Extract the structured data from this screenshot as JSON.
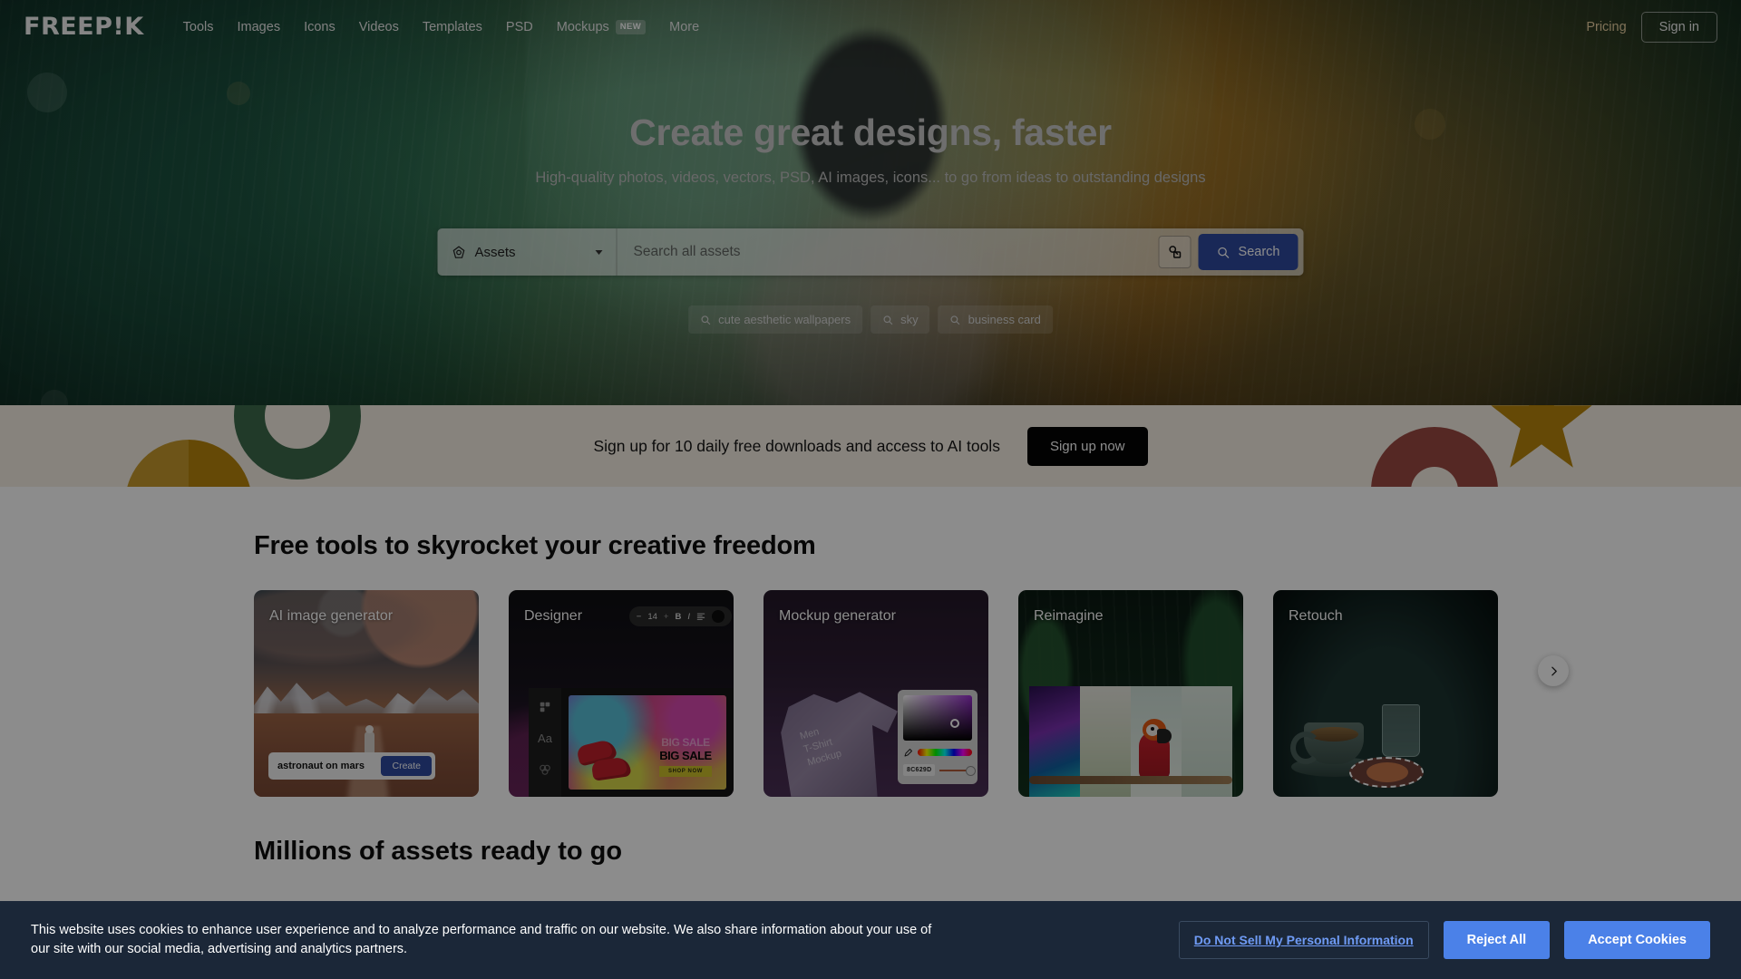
{
  "nav": {
    "logo": "FREEP!K",
    "links": [
      {
        "label": "Tools"
      },
      {
        "label": "Images"
      },
      {
        "label": "Icons"
      },
      {
        "label": "Videos"
      },
      {
        "label": "Templates"
      },
      {
        "label": "PSD"
      },
      {
        "label": "Mockups",
        "badge": "NEW"
      },
      {
        "label": "More"
      }
    ],
    "pricing_label": "Pricing",
    "signin_label": "Sign in"
  },
  "hero": {
    "title": "Create great designs, faster",
    "subtitle": "High-quality photos, videos, vectors, PSD, AI images, icons... to go from ideas to outstanding designs",
    "search": {
      "category_label": "Assets",
      "placeholder": "Search all assets",
      "value": "",
      "button_label": "Search",
      "image_search_icon": "image-search-icon"
    },
    "chips": [
      {
        "label": "cute aesthetic wallpapers"
      },
      {
        "label": "sky"
      },
      {
        "label": "business card"
      }
    ]
  },
  "signup_strip": {
    "text": "Sign up for 10 daily free downloads and access to AI tools",
    "button_label": "Sign up now",
    "shape_colors": {
      "green": "#3d6b4c",
      "yellow": "#c79a2c",
      "gold": "#b8860b",
      "red": "#9c4a42"
    }
  },
  "tools_section": {
    "title": "Free tools to skyrocket your creative freedom",
    "next_arrow_icon": "chevron-right-icon",
    "cards": [
      {
        "label": "AI image generator",
        "prompt_value": "astronaut on mars",
        "create_label": "Create"
      },
      {
        "label": "Designer",
        "toolbar": {
          "minus": "−",
          "font_size": "14",
          "plus": "+",
          "bold": "B",
          "italic": "I",
          "align": "align-left-icon"
        },
        "canvas_ghost_text": "BIG SALE",
        "canvas_text": "BIG SALE",
        "canvas_cta": "SHOP NOW",
        "sidebar_icons": [
          "grid-icon",
          "text-icon",
          "shapes-icon"
        ]
      },
      {
        "label": "Mockup generator",
        "shirt_text": "Men\nT-Shirt\nMockup",
        "color_hex": "8C629D",
        "eyedropper_icon": "eyedropper-icon"
      },
      {
        "label": "Reimagine"
      },
      {
        "label": "Retouch"
      }
    ]
  },
  "assets_section": {
    "title": "Millions of assets ready to go"
  },
  "cookie_banner": {
    "text": "This website uses cookies to enhance user experience and to analyze performance and traffic on our website. We also share information about your use of our site with our social media, advertising and analytics partners.",
    "do_not_sell_label": "Do Not Sell My Personal Information",
    "reject_label": "Reject All",
    "accept_label": "Accept Cookies",
    "accent_color": "#4b81e8",
    "background_color": "#1b2738"
  }
}
